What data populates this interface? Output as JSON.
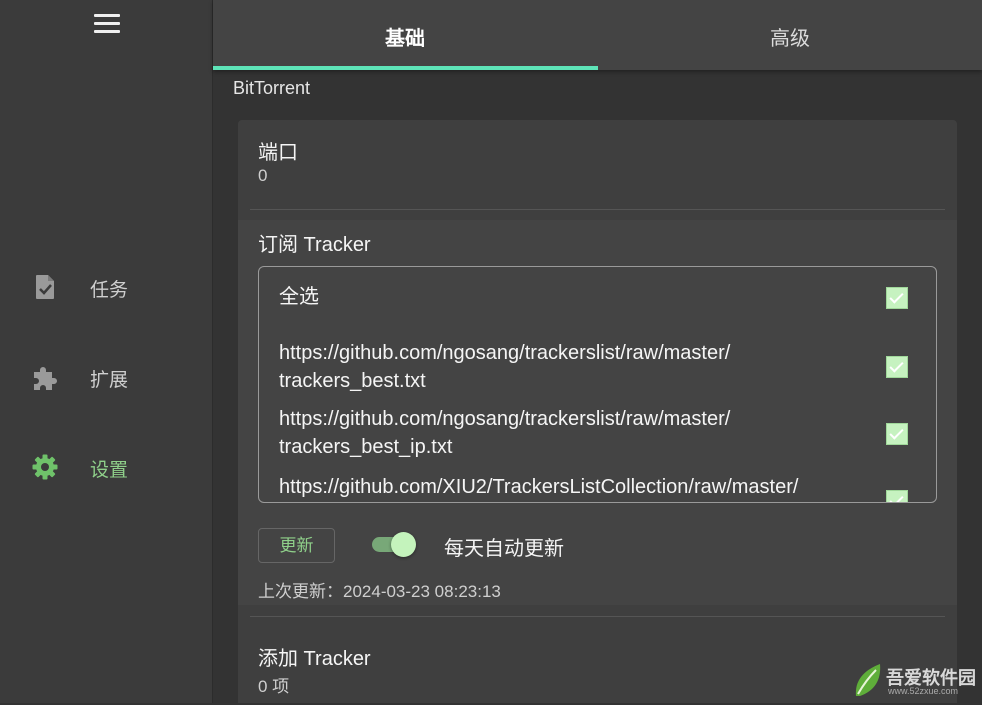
{
  "sidebar": {
    "menu_icon": "hamburger-menu-icon",
    "items": [
      {
        "label": "任务",
        "icon": "task-file-icon",
        "active": false
      },
      {
        "label": "扩展",
        "icon": "puzzle-extension-icon",
        "active": false
      },
      {
        "label": "设置",
        "icon": "gear-icon",
        "active": true
      }
    ]
  },
  "tabs": [
    {
      "label": "基础",
      "active": true
    },
    {
      "label": "高级",
      "active": false
    }
  ],
  "section": {
    "title": "BitTorrent"
  },
  "port": {
    "label": "端口",
    "value": "0"
  },
  "subscribe": {
    "label": "订阅 Tracker",
    "select_all": "全选",
    "items": [
      {
        "line1": "https://github.com/ngosang/trackerslist/raw/master/",
        "line2": "trackers_best.txt",
        "checked": true
      },
      {
        "line1": "https://github.com/ngosang/trackerslist/raw/master/",
        "line2": "trackers_best_ip.txt",
        "checked": true
      },
      {
        "line1": "https://github.com/XIU2/TrackersListCollection/raw/master/",
        "line2": "",
        "checked": true
      }
    ],
    "update_button": "更新",
    "auto_update_label": "每天自动更新",
    "auto_update_on": true,
    "last_update": "上次更新：2024-03-23 08:23:13"
  },
  "add_tracker": {
    "label": "添加 Tracker",
    "count": "0 项"
  },
  "watermark": {
    "title": "吾爱软件园",
    "url": "www.52zxue.com"
  },
  "colors": {
    "accent": "#5ee4b8",
    "active_green": "#8fd08a",
    "checkbox": "#c6f2c0"
  }
}
